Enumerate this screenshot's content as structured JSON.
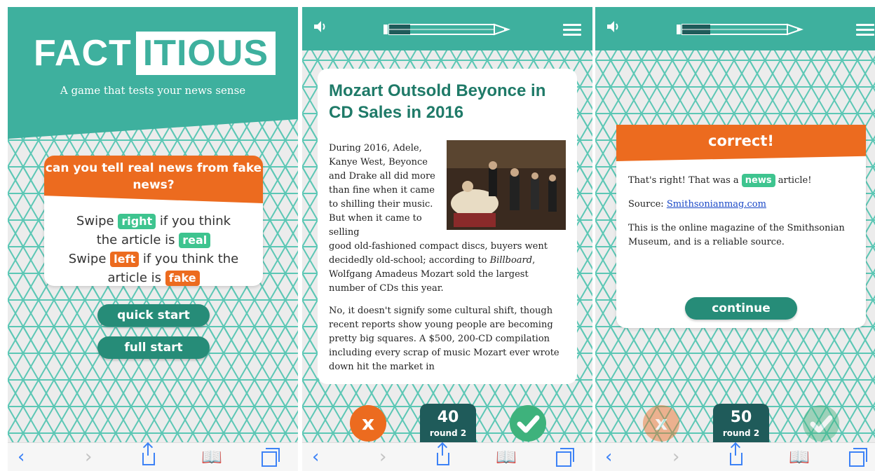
{
  "colors": {
    "teal": "#3eb09e",
    "dark_teal": "#268c78",
    "orange": "#ec6b1f",
    "green": "#3ec48f",
    "score_bg": "#1f5b5a",
    "ios_blue": "#3d82f6"
  },
  "browser_icons": [
    "chevron-left-icon",
    "chevron-right-icon",
    "share-icon",
    "bookmarks-icon",
    "tabs-icon"
  ],
  "intro": {
    "logo_left": "FACT",
    "logo_right": "ITIOUS",
    "tagline": "A game that tests your news sense",
    "banner": "can you tell real news from fake news?",
    "swipe": "Swipe",
    "right": "right",
    "if_think": "if you think",
    "the_article_is": "the article is",
    "real": "real",
    "left": "left",
    "if_think_the": "if you think the",
    "article_is": "article is",
    "fake": "fake",
    "quick_start": "quick start",
    "full_start": "full start"
  },
  "article": {
    "title": "Mozart Outsold Beyonce in CD Sales in 2016",
    "para1_wrap": "During 2016, Adele, Kanye West, Beyonce and Drake all did more than fine when it came to shilling their music. But when it came to selling",
    "para1_rest_a": "good old-fashioned compact discs, buyers went decidedly old-school; according to ",
    "para1_italic": "Billboard",
    "para1_rest_b": ", Wolfgang Amadeus Mozart sold the largest number of CDs this year.",
    "para2": "No, it doesn't signify some cultural shift, though recent reports show young people are becoming pretty big squares. A $500, 200-CD compilation including every scrap of music Mozart ever wrote down hit the market in"
  },
  "game": {
    "reject_glyph": "x",
    "score_round1": "40",
    "score_round2": "50",
    "round_label": "round 2"
  },
  "result": {
    "heading": "correct!",
    "line1_a": "That's right! That was a",
    "line1_tag": "news",
    "line1_b": "article!",
    "source_label": "Source:",
    "source_link": "Smithsonianmag.com",
    "description": "This is the online magazine of the Smithsonian Museum, and is a reliable source.",
    "continue": "continue"
  }
}
